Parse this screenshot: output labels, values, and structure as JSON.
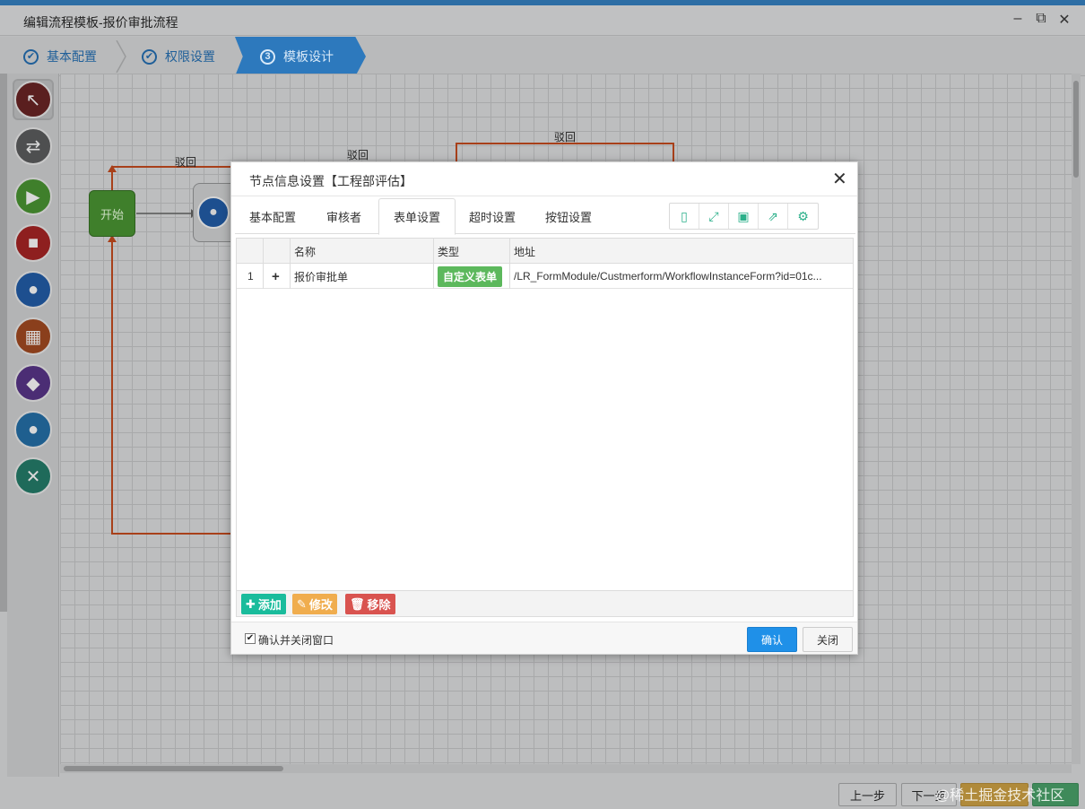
{
  "window": {
    "title": "编辑流程模板-报价审批流程"
  },
  "steps": [
    {
      "label": "基本配置",
      "icon": "✔"
    },
    {
      "label": "权限设置",
      "icon": "✔"
    },
    {
      "label": "模板设计",
      "icon": "3"
    }
  ],
  "canvas": {
    "start_label": "开始",
    "reject_labels": [
      "驳回",
      "驳回",
      "驳回"
    ]
  },
  "colors": {
    "accent": "#1f90e8",
    "green": "#5cb85c",
    "orange": "#f0ad4e",
    "red": "#d9534f",
    "teal": "#1abc9c",
    "flow_line": "#c0471b"
  },
  "bottom_buttons": {
    "prev": "上一步",
    "next": "下一步"
  },
  "dialog": {
    "title": "节点信息设置【工程部评估】",
    "tabs": [
      "基本配置",
      "审核者",
      "表单设置",
      "超时设置",
      "按钮设置"
    ],
    "active_tab": "表单设置",
    "table": {
      "columns": [
        "名称",
        "类型",
        "地址"
      ],
      "rows": [
        {
          "index": "1",
          "expand": "+",
          "name": "报价审批单",
          "type": "自定义表单",
          "url": "/LR_FormModule/Custmerform/WorkflowInstanceForm?id=01c..."
        }
      ]
    },
    "actions": {
      "add": "添加",
      "edit": "修改",
      "remove": "移除"
    },
    "footer": {
      "checkbox_label": "确认并关闭窗口",
      "checkbox_checked": true,
      "confirm": "确认",
      "close": "关闭"
    }
  },
  "watermark": "@稀土掘金技术社区"
}
